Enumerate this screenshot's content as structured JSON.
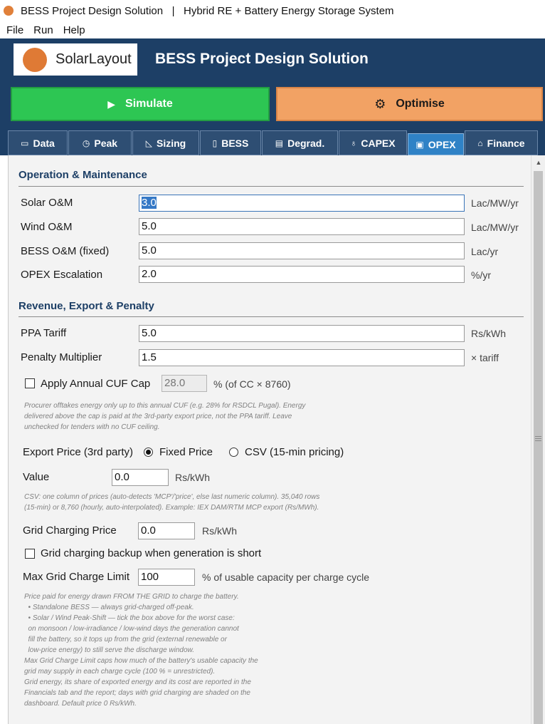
{
  "window": {
    "title": "BESS Project Design Solution   |   Hybrid RE + Battery Energy Storage System"
  },
  "menu": [
    "File",
    "Run",
    "Help"
  ],
  "header": {
    "logo_text": "SolarLayout",
    "app_title": "BESS Project Design Solution"
  },
  "actions": {
    "simulate_label": "Simulate",
    "optimise_label": "Optimise"
  },
  "tabs": [
    {
      "label": "Data",
      "icon": "folder-icon"
    },
    {
      "label": "Peak",
      "icon": "alarm-clock-icon"
    },
    {
      "label": "Sizing",
      "icon": "set-square-icon"
    },
    {
      "label": "BESS",
      "icon": "battery-icon"
    },
    {
      "label": "Degrad.",
      "icon": "chart-down-icon"
    },
    {
      "label": "CAPEX",
      "icon": "money-bag-icon"
    },
    {
      "label": "OPEX",
      "icon": "calendar-icon",
      "active": true
    },
    {
      "label": "Finance",
      "icon": "bank-icon"
    }
  ],
  "om": {
    "heading": "Operation & Maintenance",
    "fields": [
      {
        "label": "Solar O&M",
        "value": "3.0",
        "unit": "Lac/MW/yr"
      },
      {
        "label": "Wind O&M",
        "value": "5.0",
        "unit": "Lac/MW/yr"
      },
      {
        "label": "BESS O&M (fixed)",
        "value": "5.0",
        "unit": "Lac/yr"
      },
      {
        "label": "OPEX Escalation",
        "value": "2.0",
        "unit": "%/yr"
      }
    ]
  },
  "revenue": {
    "heading": "Revenue, Export & Penalty",
    "fields": [
      {
        "label": "PPA Tariff",
        "value": "5.0",
        "unit": "Rs/kWh"
      },
      {
        "label": "Penalty Multiplier",
        "value": "1.5",
        "unit": "× tariff"
      }
    ],
    "cuf_cap": {
      "label": "Apply Annual CUF Cap",
      "checked": false,
      "value": "28.0",
      "unit": "% (of CC × 8760)"
    },
    "cuf_note": "Procurer offtakes energy only up to this annual CUF (e.g. 28% for RSDCL Pugal). Energy\ndelivered above the cap is paid at the 3rd-party export price, not the PPA tariff. Leave\nunchecked for tenders with no CUF ceiling.",
    "export": {
      "label": "Export Price (3rd party)",
      "options": [
        "Fixed Price",
        "CSV (15-min pricing)"
      ],
      "selected": "Fixed Price"
    },
    "export_value": {
      "label": "Value",
      "value": "0.0",
      "unit": "Rs/kWh"
    },
    "csv_note": "CSV: one column of prices (auto-detects 'MCP'/'price', else last numeric column). 35,040 rows\n(15-min) or 8,760 (hourly, auto-interpolated). Example: IEX DAM/RTM MCP export (Rs/MWh).",
    "grid_price": {
      "label": "Grid Charging Price",
      "value": "0.0",
      "unit": "Rs/kWh"
    },
    "grid_backup": {
      "label": "Grid charging backup when generation is short",
      "checked": false
    },
    "grid_limit": {
      "label": "Max Grid Charge Limit",
      "value": "100",
      "unit": "% of usable capacity per charge cycle"
    },
    "grid_note": "Price paid for energy drawn FROM THE GRID to charge the battery.\n  • Standalone BESS — always grid-charged off-peak.\n  • Solar / Wind Peak-Shift — tick the box above for the worst case:\n  on monsoon / low-irradiance / low-wind days the generation cannot\n  fill the battery, so it tops up from the grid (external renewable or\n  low-price energy) to still serve the discharge window.\nMax Grid Charge Limit caps how much of the battery's usable capacity the\ngrid may supply in each charge cycle (100 % = unrestricted).\nGrid energy, its share of exported energy and its cost are reported in the\nFinancials tab and the report; days with grid charging are shaded on the\ndashboard. Default price 0 Rs/kWh."
  }
}
